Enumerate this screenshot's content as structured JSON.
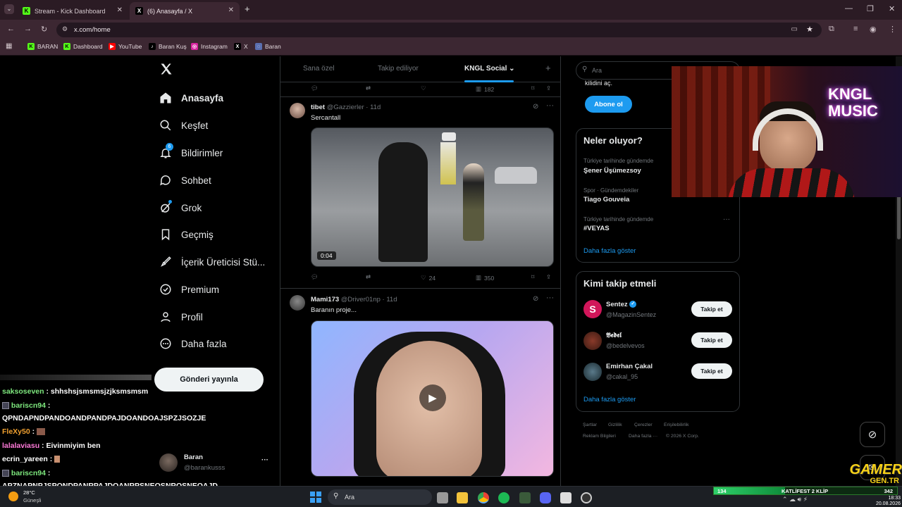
{
  "browser": {
    "tabs": [
      {
        "title": "Stream - Kick Dashboard",
        "icon": "kick-icon"
      },
      {
        "title": "(6) Anasayfa / X",
        "icon": "x-icon"
      }
    ],
    "url": "x.com/home",
    "bookmarks": [
      "BARAN",
      "Dashboard",
      "YouTube",
      "Baran Kuş",
      "Instagram",
      "X",
      "Baran"
    ]
  },
  "sidebar": {
    "items": [
      {
        "label": "Anasayfa",
        "icon": "home-icon"
      },
      {
        "label": "Keşfet",
        "icon": "search-icon"
      },
      {
        "label": "Bildirimler",
        "icon": "bell-icon",
        "badge": "6"
      },
      {
        "label": "Sohbet",
        "icon": "chat-icon"
      },
      {
        "label": "Grok",
        "icon": "grok-icon"
      },
      {
        "label": "Geçmiş",
        "icon": "bookmark-icon"
      },
      {
        "label": "İçerik Üreticisi Stü...",
        "icon": "rocket-icon"
      },
      {
        "label": "Premium",
        "icon": "verified-icon"
      },
      {
        "label": "Profil",
        "icon": "person-icon"
      },
      {
        "label": "Daha fazla",
        "icon": "more-circle-icon"
      }
    ],
    "post_button": "Gönderi yayınla",
    "account": {
      "name": "Baran",
      "handle": "@barankusss",
      "more": "···"
    }
  },
  "chat": [
    {
      "user": "saksoseven",
      "color": "#7ee87e",
      "msg": ": shhshsjsmsmsjzjksmsmsm"
    },
    {
      "user": "bariscn94",
      "color": "#7ee87e",
      "msg": ":"
    },
    {
      "user": "",
      "color": "#ffffff",
      "msg": "QPNDAPNDPANDOANDPANDPAJDOANDOAJSPZJSOZJE"
    },
    {
      "user": "FleXy50",
      "color": "#f0a030",
      "msg": ":"
    },
    {
      "user": "lalalaviasu",
      "color": "#ff7ad9",
      "msg": ": Eivinmiyim ben"
    },
    {
      "user": "ecrin_yareen",
      "color": "#ffffff",
      "msg": ":"
    },
    {
      "user": "bariscn94",
      "color": "#7ee87e",
      "msg": ":"
    },
    {
      "user": "",
      "color": "#ffffff",
      "msg": "APZNAPNPJSPQNDPANRPAJDOANRPSNEOSNROSNEOAJD"
    }
  ],
  "timeline": {
    "tabs": [
      "Sana özel",
      "Takip ediliyor",
      "KNGL Social",
      "+"
    ],
    "active_tab": 2,
    "top_views": "182",
    "posts": [
      {
        "name": "tibet",
        "handle": "@Gazzierler",
        "time": "11d",
        "text": "Sercantall",
        "duration": "0:04",
        "likes": "24",
        "views": "350"
      },
      {
        "name": "Mami173",
        "handle": "@Driver01np",
        "time": "11d",
        "text": "Baranın proje..."
      }
    ]
  },
  "right": {
    "search_placeholder": "Ara",
    "premium_text": "kilidini aç.",
    "subscribe": "Abone ol",
    "trends_title": "Neler oluyor?",
    "trends": [
      {
        "meta": "Türkiye tarihinde gündemde",
        "name": "Şener Üşümezsoy"
      },
      {
        "meta": "Spor · Gündemdekiler",
        "name": "Tiago Gouveia"
      },
      {
        "meta": "Türkiye tarihinde gündemde",
        "name": "#VEYAS"
      }
    ],
    "show_more": "Daha fazla göster",
    "who_title": "Kimi takip etmeli",
    "who": [
      {
        "name": "Sentez",
        "handle": "@MagazinSentez",
        "verified": true
      },
      {
        "name": "𝕭𝖊𝖉𝖊𝖑",
        "handle": "@bedelvevos",
        "verified": false
      },
      {
        "name": "Emirhan Çakal",
        "handle": "@cakal_95",
        "verified": false
      }
    ],
    "follow_label": "Takip et",
    "footer_links": [
      "Şartlar",
      "Gizlilik",
      "Çerezler",
      "Erişilebilirlik",
      "Reklam Bilgileri",
      "Daha fazla ···",
      "© 2026 X Corp."
    ]
  },
  "overlay": {
    "logo_line1": "GAMER",
    "logo_line2": "GEN.TR",
    "webcam_sign": "KNGL MUSIC",
    "progress_value": "134",
    "progress_label": "KATLİFEST 2 KLİP",
    "progress_goal": "342"
  },
  "taskbar": {
    "weather_temp": "28°C",
    "weather_text": "Güneşli",
    "search": "Ara",
    "time": "18:33",
    "date": "20.08.2026"
  }
}
